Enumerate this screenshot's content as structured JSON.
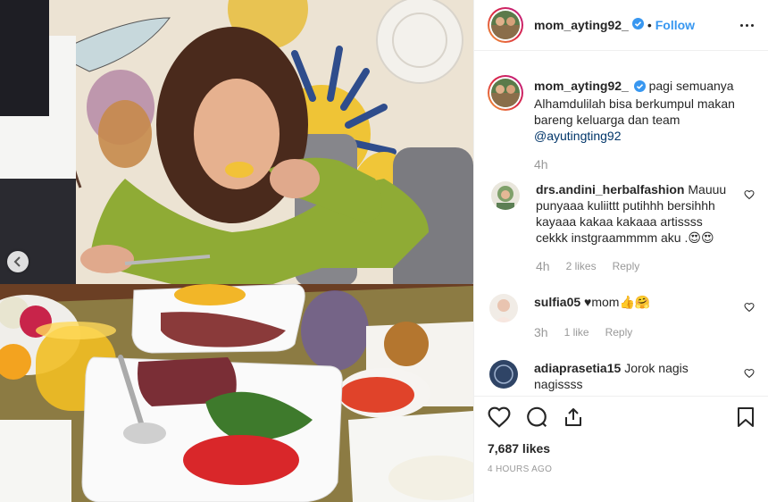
{
  "post": {
    "username": "mom_ayting92_",
    "follow_label": "Follow",
    "dot": "•"
  },
  "caption": {
    "username": "mom_ayting92_",
    "text": "pagi semuanya Alhamdulilah bisa berkumpul makan bareng keluarga dan team",
    "mention": "@ayutingting92",
    "time": "4h"
  },
  "comments": [
    {
      "username": "drs.andini_herbalfashion",
      "text": "Mauuu punyaaa kuliittt putihhh bersihhh kayaaa kakaa kakaaa artissss cekkk instgraammmm aku .😍😍",
      "time": "4h",
      "likes": "2 likes",
      "reply": "Reply"
    },
    {
      "username": "sulfia05",
      "text": "♥mom👍🤗",
      "time": "3h",
      "likes": "1 like",
      "reply": "Reply"
    },
    {
      "username": "adiaprasetia15",
      "text": "Jorok nagis nagissss",
      "time": "",
      "likes": "",
      "reply": ""
    }
  ],
  "footer": {
    "likes_count": "7,687 likes",
    "time_ago": "4 HOURS AGO"
  },
  "colors": {
    "link_blue": "#3897f0",
    "verified_blue": "#3897f0",
    "muted": "#999999",
    "text": "#262626"
  },
  "icons": [
    "verified-badge-icon",
    "more-options-icon",
    "heart-icon",
    "comment-icon",
    "share-icon",
    "bookmark-icon",
    "chevron-left-icon"
  ]
}
